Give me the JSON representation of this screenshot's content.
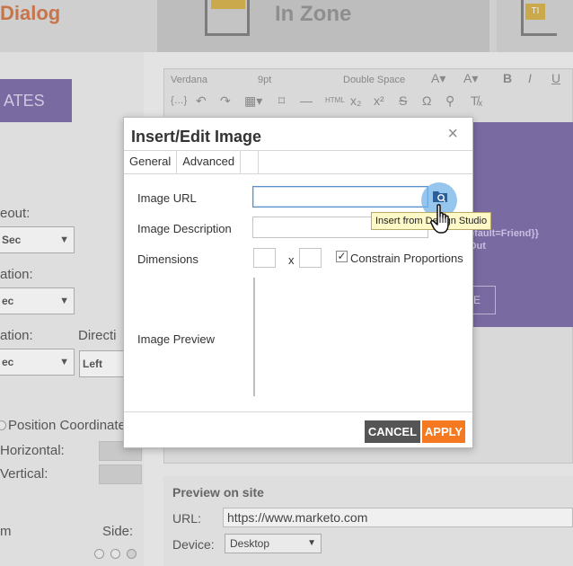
{
  "background": {
    "page_title_fragment": "Dialog",
    "zone_text": "In Zone",
    "zone_badge": "TI",
    "templates_btn": "ATES",
    "labels": {
      "timeout": "eout:",
      "animation": "ation:",
      "animation2": "ation:",
      "direction": "Directi",
      "position": "Position Coordinate",
      "horizontal": "Horizontal:",
      "vertical": "Vertical:",
      "m": "m",
      "side": "Side:"
    },
    "selects": {
      "s1": "Sec",
      "s2": "ec",
      "s3": "ec",
      "s4": "Left"
    },
    "editor_toolbar": {
      "font": "Verdana",
      "size": "9pt",
      "spacing": "Double Space"
    },
    "purple_text_1": "efault=Friend}}",
    "purple_text_2": "Out",
    "purple_btn": "E",
    "preview": {
      "title": "Preview on site",
      "url_label": "URL:",
      "url_value": "https://www.marketo.com",
      "device_label": "Device:",
      "device_value": "Desktop"
    }
  },
  "dialog": {
    "title": "Insert/Edit Image",
    "close_glyph": "×",
    "tabs": [
      {
        "label": "General"
      },
      {
        "label": "Advanced"
      }
    ],
    "fields": {
      "image_url_label": "Image URL",
      "image_url_value": "",
      "image_description_label": "Image Description",
      "image_description_value": "",
      "dimensions_label": "Dimensions",
      "dimensions_separator": "x",
      "width_value": "",
      "height_value": "",
      "constrain_checked": true,
      "constrain_label": "Constrain Proportions",
      "image_preview_label": "Image Preview"
    },
    "buttons": {
      "cancel": "CANCEL",
      "apply": "APPLY"
    },
    "tooltip": "Insert from Design Studio"
  },
  "colors": {
    "apply": "#f47920",
    "cancel": "#555555",
    "browse_halo": "#73b3e8",
    "tooltip_bg": "#fff9c7",
    "purple": "#7a6aa2"
  }
}
